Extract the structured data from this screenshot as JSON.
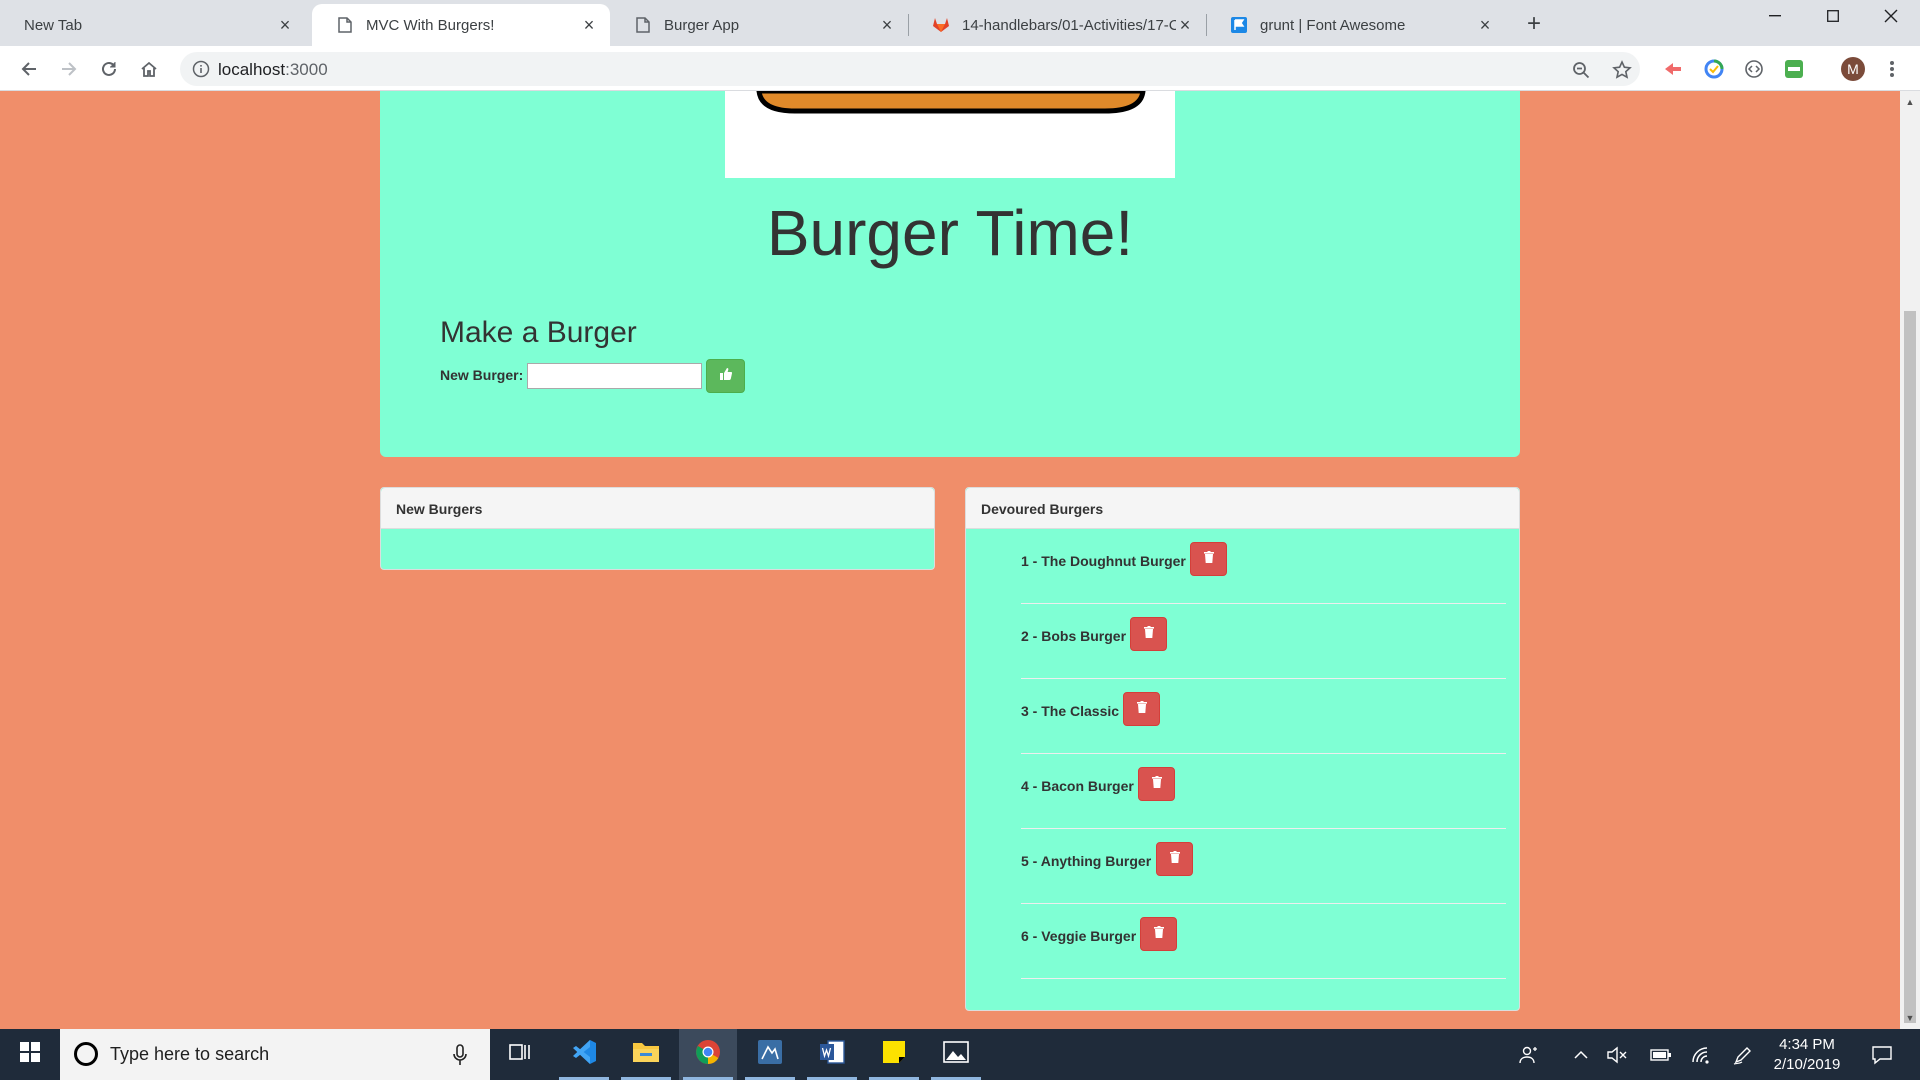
{
  "browser": {
    "tabs": [
      {
        "title": "New Tab",
        "icon": "none",
        "active": false
      },
      {
        "title": "MVC With Burgers!",
        "icon": "page-icon",
        "active": true
      },
      {
        "title": "Burger App",
        "icon": "page-icon",
        "active": false
      },
      {
        "title": "14-handlebars/01-Activities/17-C",
        "icon": "gitlab-icon",
        "active": false
      },
      {
        "title": "grunt | Font Awesome",
        "icon": "font-awesome-icon",
        "active": false
      }
    ],
    "url_host": "localhost",
    "url_port": ":3000"
  },
  "page": {
    "title": "Burger Time!",
    "make_title": "Make a Burger",
    "form_label": "New Burger:",
    "input_value": "",
    "add_button_icon": "thumbs-up-icon",
    "new_panel_title": "New Burgers",
    "devoured_panel_title": "Devoured Burgers",
    "devoured": [
      {
        "label": "1 - The Doughnut Burger"
      },
      {
        "label": "2 - Bobs Burger"
      },
      {
        "label": "3 - The Classic"
      },
      {
        "label": "4 - Bacon Burger"
      },
      {
        "label": "5 - Anything Burger"
      },
      {
        "label": "6 - Veggie Burger"
      }
    ],
    "delete_icon": "trash-icon",
    "colors": {
      "background": "#f08e6a",
      "panel": "#7fffd4",
      "add_button": "#5cb85c",
      "delete_button": "#d9534f"
    }
  },
  "taskbar": {
    "search_placeholder": "Type here to search",
    "time": "4:34 PM",
    "date": "2/10/2019"
  }
}
